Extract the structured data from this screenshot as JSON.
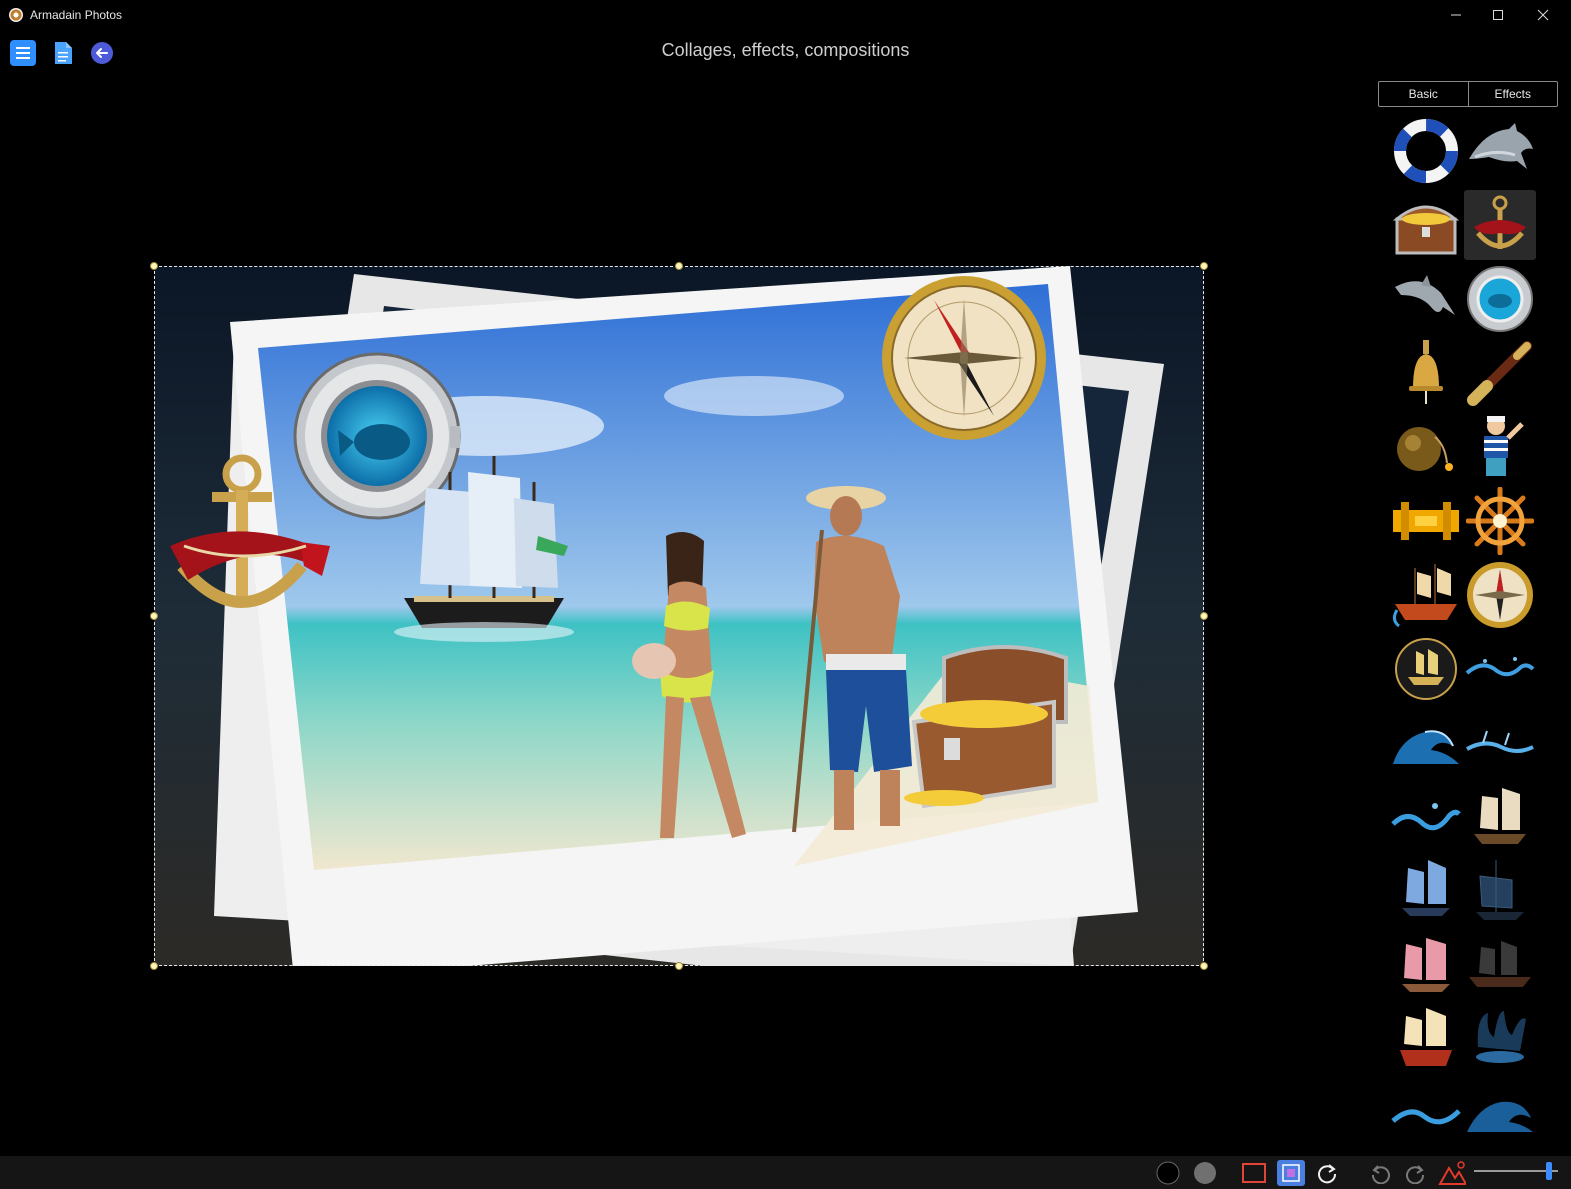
{
  "window": {
    "title": "Armadain Photos",
    "controls": [
      "minimize",
      "maximize",
      "close"
    ]
  },
  "toolbar": {
    "buttons": [
      {
        "name": "menu",
        "icon": "hamburger-menu-icon",
        "color": "#2f8fff"
      },
      {
        "name": "document",
        "icon": "document-icon",
        "color": "#4aa3ff"
      },
      {
        "name": "back",
        "icon": "back-arrow-icon",
        "color": "#4e5bd8"
      }
    ]
  },
  "header": {
    "title": "Collages, effects, compositions"
  },
  "panel": {
    "tabs": [
      {
        "label": "Basic",
        "active": true
      },
      {
        "label": "Effects",
        "active": false
      }
    ],
    "items": [
      {
        "icon": "lifebuoy-icon"
      },
      {
        "icon": "dolphin-icon"
      },
      {
        "icon": "treasure-chest-icon"
      },
      {
        "icon": "anchor-ribbon-icon",
        "selected": true
      },
      {
        "icon": "jumping-dolphin-icon"
      },
      {
        "icon": "porthole-fish-icon"
      },
      {
        "icon": "ship-bell-icon"
      },
      {
        "icon": "spyglass-icon"
      },
      {
        "icon": "cannonball-bomb-icon"
      },
      {
        "icon": "sailor-icon"
      },
      {
        "icon": "golden-bridge-icon"
      },
      {
        "icon": "ship-wheel-icon"
      },
      {
        "icon": "pirate-ship-icon"
      },
      {
        "icon": "compass-icon"
      },
      {
        "icon": "ship-emblem-icon"
      },
      {
        "icon": "water-splash-icon"
      },
      {
        "icon": "wave-icon"
      },
      {
        "icon": "water-splash-icon"
      },
      {
        "icon": "water-splash-icon"
      },
      {
        "icon": "sailing-ship-icon"
      },
      {
        "icon": "sailing-ship-icon"
      },
      {
        "icon": "sailing-ship-icon"
      },
      {
        "icon": "pink-ship-icon"
      },
      {
        "icon": "galleon-icon"
      },
      {
        "icon": "red-galleon-icon"
      },
      {
        "icon": "water-crown-splash-icon"
      },
      {
        "icon": "water-splash-icon"
      },
      {
        "icon": "wave-icon"
      }
    ]
  },
  "canvas": {
    "layers": [
      "beach-photo",
      "anchor-sticker",
      "porthole-sticker",
      "ship-sticker",
      "compass-sticker",
      "treasure-chest-sticker"
    ]
  },
  "statusbar": {
    "tools": [
      {
        "name": "color-black",
        "icon": "black-circle-icon"
      },
      {
        "name": "color-gray",
        "icon": "gray-circle-icon"
      },
      {
        "name": "frame",
        "icon": "rectangle-frame-icon"
      },
      {
        "name": "layer",
        "icon": "layer-icon",
        "active": true
      },
      {
        "name": "refresh",
        "icon": "refresh-icon"
      },
      {
        "name": "undo",
        "icon": "undo-icon"
      },
      {
        "name": "redo",
        "icon": "redo-icon"
      },
      {
        "name": "effects",
        "icon": "mountain-effects-icon"
      }
    ],
    "zoom_fraction": 0.92
  },
  "colors": {
    "accent": "#3d8cff",
    "background": "#000000",
    "statusbar": "#151515"
  }
}
